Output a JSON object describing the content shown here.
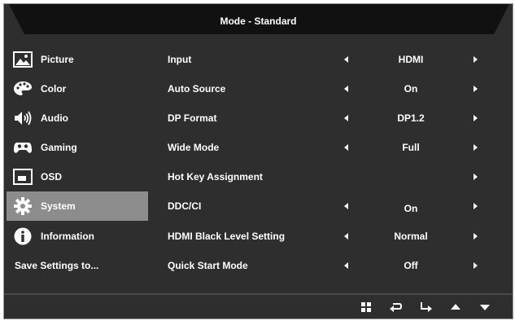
{
  "header": {
    "title": "Mode - Standard"
  },
  "sidebar": {
    "items": [
      {
        "label": "Picture",
        "icon": "picture-icon"
      },
      {
        "label": "Color",
        "icon": "palette-icon"
      },
      {
        "label": "Audio",
        "icon": "speaker-icon"
      },
      {
        "label": "Gaming",
        "icon": "gamepad-icon"
      },
      {
        "label": "OSD",
        "icon": "osd-icon"
      },
      {
        "label": "System",
        "icon": "gear-icon",
        "selected": true
      },
      {
        "label": "Information",
        "icon": "info-icon"
      },
      {
        "label": "Save Settings to...",
        "icon": ""
      }
    ]
  },
  "settings": [
    {
      "label": "Input",
      "value": "HDMI"
    },
    {
      "label": "Auto Source",
      "value": "On"
    },
    {
      "label": "DP Format",
      "value": "DP1.2"
    },
    {
      "label": "Wide Mode",
      "value": "Full"
    },
    {
      "label": "Hot Key Assignment",
      "value": ""
    },
    {
      "label": "DDC/CI",
      "value": "On"
    },
    {
      "label": "HDMI Black Level Setting",
      "value": "Normal"
    },
    {
      "label": "Quick Start Mode",
      "value": "Off"
    }
  ],
  "footer": {
    "buttons": [
      "menu-grid-icon",
      "back-icon",
      "enter-icon",
      "up-icon",
      "down-icon"
    ]
  },
  "colors": {
    "background": "#2e2e2e",
    "selected": "#8c8c8c",
    "titlebar": "#111111",
    "text": "#ffffff"
  }
}
